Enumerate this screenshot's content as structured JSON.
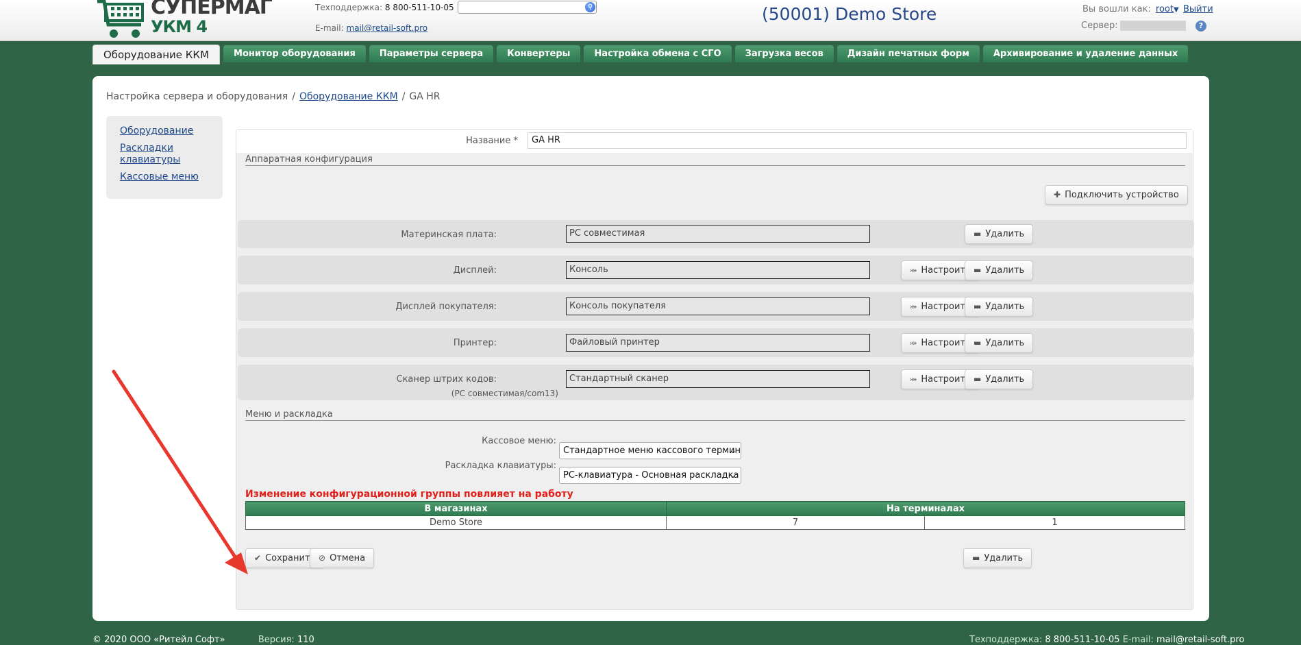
{
  "header": {
    "logo_line1": "СУПЕРМАГ",
    "logo_line2": "УКМ 4",
    "support_label": "Техподдержка:",
    "support_phone": "8 800-511-10-05",
    "email_label": "E-mail:",
    "email": "mail@retail-soft.pro",
    "search_value": "",
    "store_title": "(50001) Demo Store",
    "logged_label": "Вы вошли как:",
    "user": "root",
    "logout": "Выйти",
    "server_label": "Сервер:",
    "help": "?"
  },
  "nav": {
    "tabs": [
      "Оборудование ККМ",
      "Монитор оборудования",
      "Параметры сервера",
      "Конвертеры",
      "Настройка обмена с СГО",
      "Загрузка весов",
      "Дизайн печатных форм",
      "Архивирование и удаление данных"
    ],
    "active": "Оборудование ККМ"
  },
  "breadcrumb": {
    "root": "Настройка сервера и оборудования",
    "sep": "/",
    "link": "Оборудование ККМ",
    "current": "GA HR"
  },
  "sidebar": {
    "items": [
      "Оборудование",
      "Раскладки клавиатуры",
      "Кассовые меню"
    ]
  },
  "form": {
    "name_label": "Название *",
    "name_value": "GA HR",
    "hw_section": "Аппаратная конфигурация",
    "connect_button": "Подключить устройство",
    "configure_label": "Настроить",
    "delete_label": "Удалить",
    "devices": [
      {
        "label": "Материнская плата:",
        "value": "PC совместимая",
        "configurable": false
      },
      {
        "label": "Дисплей:",
        "value": "Консоль",
        "configurable": true
      },
      {
        "label": "Дисплей покупателя:",
        "value": "Консоль покупателя",
        "configurable": true
      },
      {
        "label": "Принтер:",
        "value": "Файловый принтер",
        "configurable": true
      },
      {
        "label": "Сканер штрих кодов:",
        "value": "Стандартный сканер",
        "sub": "(PC совместимая/com13)",
        "configurable": true
      }
    ],
    "menu_section": "Меню и раскладка",
    "cash_menu_label": "Кассовое меню:",
    "cash_menu_value": "Стандартное меню кассового терминала",
    "keyboard_label": "Раскладка клавиатуры:",
    "keyboard_value": "PC-клавиатура - Основная раскладка",
    "warning": "Изменение конфигурационной группы повлияет на работу",
    "table": {
      "headers": [
        "В магазинах",
        "На терминалах"
      ],
      "row": [
        "Demo Store",
        "7",
        "1"
      ]
    },
    "save_button": "Сохранить",
    "cancel_button": "Отмена",
    "delete_button": "Удалить"
  },
  "footer": {
    "copyright": "© 2020 ООО «Ритейл Софт»",
    "version_label": "Версия:",
    "version": "110",
    "support_label": "Техподдержка:",
    "support_phone": "8 800-511-10-05",
    "email_label": "E-mail:",
    "email": "mail@retail-soft.pro"
  },
  "colors": {
    "background": "#2f6446",
    "accent_green": "#3f8a5e",
    "title_blue": "#27478b",
    "warning_red": "#e0201b",
    "annotation_arrow": "#e8382e"
  }
}
